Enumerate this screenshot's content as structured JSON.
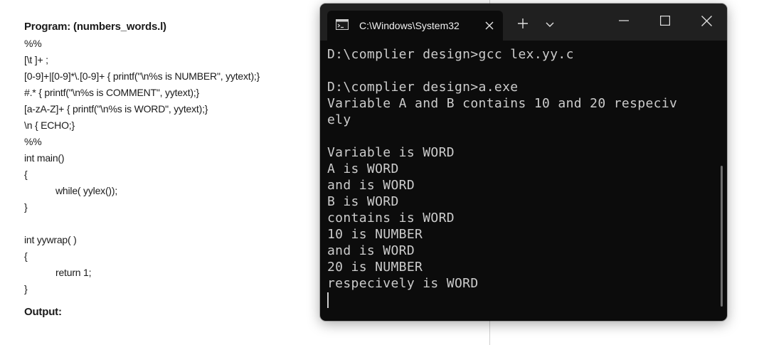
{
  "document": {
    "title": "Program: (numbers_words.l)",
    "code_lines": [
      {
        "text": "%%",
        "indent": false
      },
      {
        "text": "[\\t ]+ ;",
        "indent": false
      },
      {
        "text": "[0-9]+|[0-9]*\\.[0-9]+ { printf(\"\\n%s is NUMBER\", yytext);}",
        "indent": false
      },
      {
        "text": "#.* { printf(\"\\n%s is COMMENT\", yytext);}",
        "indent": false
      },
      {
        "text": "[a-zA-Z]+ { printf(\"\\n%s is WORD\", yytext);}",
        "indent": false
      },
      {
        "text": "\\n { ECHO;}",
        "indent": false
      },
      {
        "text": "%%",
        "indent": false
      },
      {
        "text": "int main()",
        "indent": false
      },
      {
        "text": "{",
        "indent": false
      },
      {
        "text": "while( yylex());",
        "indent": true
      },
      {
        "text": "}",
        "indent": false
      },
      {
        "text": "",
        "indent": false
      },
      {
        "text": "int yywrap( )",
        "indent": false
      },
      {
        "text": "{",
        "indent": false
      },
      {
        "text": "return 1;",
        "indent": true
      },
      {
        "text": "}",
        "indent": false
      }
    ],
    "output_heading": "Output:"
  },
  "terminal": {
    "tab_title": "C:\\Windows\\System32",
    "icons": {
      "tab_icon": "cmd-icon",
      "tab_close": "close-icon",
      "new_tab": "plus-icon",
      "dropdown": "chevron-down-icon",
      "minimize": "minimize-icon",
      "maximize": "maximize-icon",
      "close": "close-icon"
    },
    "lines": [
      "D:\\complier design>gcc lex.yy.c",
      "",
      "D:\\complier design>a.exe",
      "Variable A and B contains 10 and 20 respeciv",
      "ely",
      "",
      "Variable is WORD",
      "A is WORD",
      "and is WORD",
      "B is WORD",
      "contains is WORD",
      "10 is NUMBER",
      "and is WORD",
      "20 is NUMBER",
      "respecively is WORD"
    ],
    "colors": {
      "background": "#0c0c0c",
      "titlebar": "#202020",
      "text": "#cccccc"
    }
  }
}
